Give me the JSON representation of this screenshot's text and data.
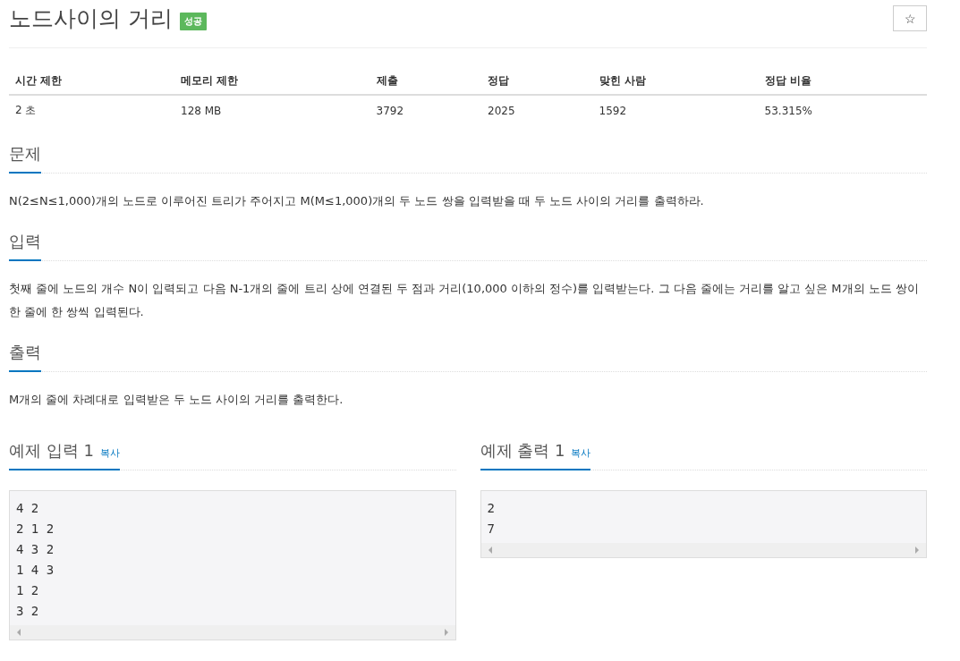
{
  "title": "노드사이의 거리",
  "badge": "성공",
  "star_button": "☆",
  "info_table": {
    "columns": [
      "시간 제한",
      "메모리 제한",
      "제출",
      "정답",
      "맞힌 사람",
      "정답 비율"
    ],
    "rows": [
      [
        "2 초",
        "128 MB",
        "3792",
        "2025",
        "1592",
        "53.315%"
      ]
    ]
  },
  "sections": [
    {
      "heading": "문제",
      "text": "N(2≤N≤1,000)개의 노드로 이루어진 트리가 주어지고 M(M≤1,000)개의 두 노드 쌍을 입력받을 때 두 노드 사이의 거리를 출력하라."
    },
    {
      "heading": "입력",
      "text": "첫째 줄에 노드의 개수 N이 입력되고 다음 N-1개의 줄에 트리 상에 연결된 두 점과 거리(10,000 이하의 정수)를 입력받는다. 그 다음 줄에는 거리를 알고 싶은 M개의 노드 쌍이 한 줄에 한 쌍씩 입력된다."
    },
    {
      "heading": "출력",
      "text": "M개의 줄에 차례대로 입력받은 두 노드 사이의 거리를 출력한다."
    }
  ],
  "samples": [
    {
      "heading": "예제 입력 1",
      "copy": "복사",
      "lines": [
        "4 2",
        "2 1 2",
        "4 3 2",
        "1 4 3",
        "1 2",
        "3 2"
      ]
    },
    {
      "heading": "예제 출력 1",
      "copy": "복사",
      "lines": [
        "2",
        "7"
      ]
    }
  ]
}
